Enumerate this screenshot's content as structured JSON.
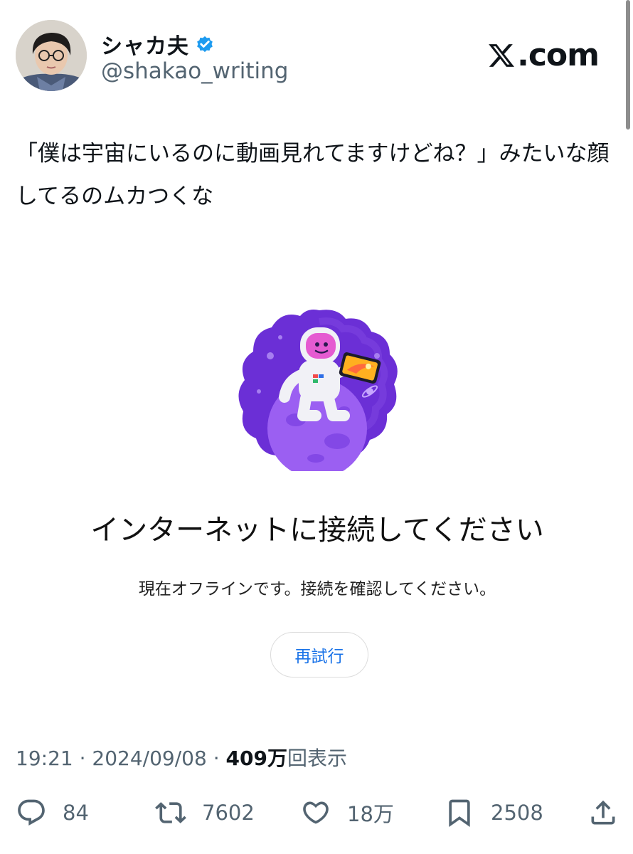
{
  "author": {
    "display_name": "シャカ夫",
    "handle": "@shakao_writing",
    "verified": true,
    "verified_color": "#1d9bf0"
  },
  "brand": {
    "label": ".com",
    "icon": "x-logo-icon"
  },
  "tweet": {
    "text": "「僕は宇宙にいるのに動画見れてますけどね？」みたいな顔してるのムカつくな"
  },
  "media": {
    "illustration": "astronaut-on-planet-with-tablet",
    "title": "インターネットに接続してください",
    "description": "現在オフラインです。接続を確認してください。",
    "retry_label": "再試行",
    "accent_color": "#1a73e8"
  },
  "meta": {
    "time": "19:21",
    "separator": " · ",
    "date": "2024/09/08",
    "views_value": "409万",
    "views_label": "回表示"
  },
  "actions": {
    "replies": {
      "icon": "reply-icon",
      "count": "84"
    },
    "reposts": {
      "icon": "repost-icon",
      "count": "7602"
    },
    "likes": {
      "icon": "heart-icon",
      "count": "18万"
    },
    "bookmarks": {
      "icon": "bookmark-icon",
      "count": "2508"
    },
    "share": {
      "icon": "share-icon"
    }
  }
}
